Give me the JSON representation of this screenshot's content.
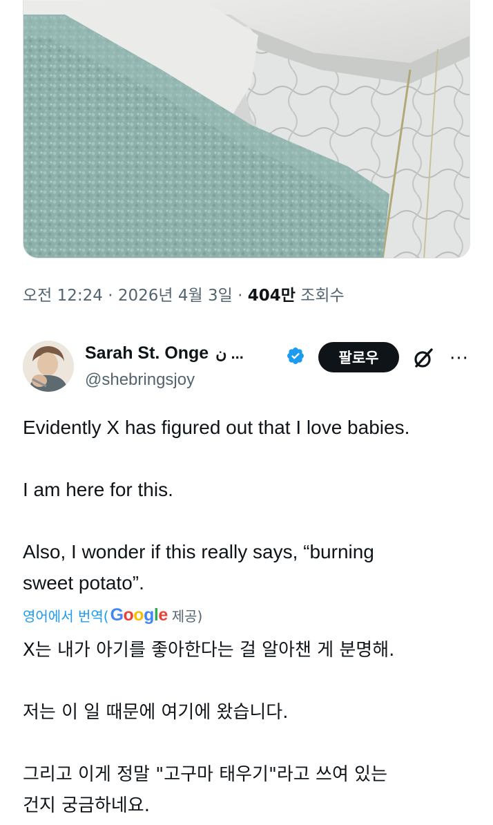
{
  "media": {
    "alt_icon": "photo-towel-and-quilt"
  },
  "meta": {
    "time": "오전 12:24",
    "separator": "·",
    "date": "2026년 4월 3일",
    "views_count": "404만",
    "views_label": "조회수"
  },
  "author": {
    "display_name": "Sarah St. Onge",
    "name_suffix": "ن ...",
    "handle": "@shebringsjoy",
    "verified_icon": "verified-badge-icon",
    "avatar_icon": "avatar-photo"
  },
  "actions": {
    "follow_label": "팔로우",
    "grok_icon": "grok-icon",
    "more_label": "···"
  },
  "tweet": {
    "line1": "Evidently X has figured out that I love babies.",
    "line2": "I am here for this.",
    "line3a": "Also, I wonder if this really says, “burning",
    "line3b": "sweet potato”."
  },
  "translation": {
    "prefix": "영어에서 번역(",
    "brand": "Google",
    "suffix": "제공)",
    "line1": "X는 내가 아기를 좋아한다는 걸 알아챈 게 분명해.",
    "line2": "저는 이 일 때문에 여기에 왔습니다.",
    "line3a": "그리고 이게 정말 \"고구마 태우기\"라고 쓰여 있는",
    "line3b": "건지 궁금하네요."
  },
  "colors": {
    "text": "#0f1419",
    "secondary": "#536471",
    "link": "#1d9bf0",
    "verified": "#1d9bf0",
    "towel": "#8fb1ad",
    "follow_bg": "#0f1419"
  }
}
